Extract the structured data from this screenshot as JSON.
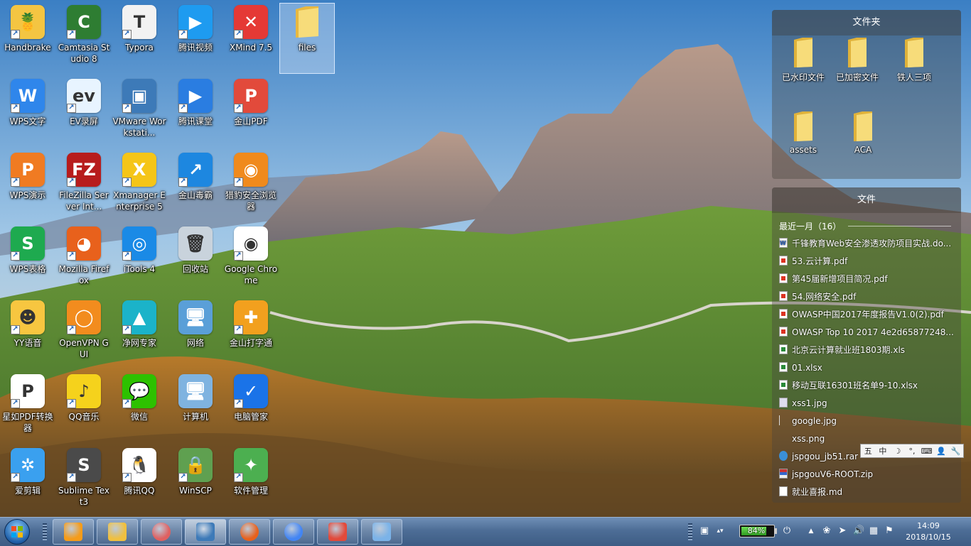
{
  "desktop": {
    "icons": [
      {
        "label": "Handbrake",
        "icon": "pineapple-icon",
        "bg": "#f4c542",
        "glyph": "🍍"
      },
      {
        "label": "Camtasia Studio 8",
        "icon": "camtasia-icon",
        "bg": "#2e7d32",
        "glyph": "C"
      },
      {
        "label": "Typora",
        "icon": "typora-icon",
        "bg": "#f2f2f2",
        "glyph": "T"
      },
      {
        "label": "腾讯视频",
        "icon": "tencent-video-icon",
        "bg": "#1e9bf0",
        "glyph": "▶"
      },
      {
        "label": "XMind 7.5",
        "icon": "xmind-icon",
        "bg": "#e53935",
        "glyph": "✕"
      },
      {
        "label": "files",
        "icon": "folder-icon",
        "bg": "#f3d36b",
        "glyph": ""
      },
      {
        "label": "WPS文字",
        "icon": "wps-writer-icon",
        "bg": "#2f86eb",
        "glyph": "W"
      },
      {
        "label": "EV录屏",
        "icon": "ev-recorder-icon",
        "bg": "#e8f4ff",
        "glyph": "ev"
      },
      {
        "label": "VMware Workstati...",
        "icon": "vmware-icon",
        "bg": "#3d7ab8",
        "glyph": "▣"
      },
      {
        "label": "腾讯课堂",
        "icon": "tencent-class-icon",
        "bg": "#2a7de1",
        "glyph": "▶"
      },
      {
        "label": "金山PDF",
        "icon": "kingsoft-pdf-icon",
        "bg": "#e24a3b",
        "glyph": "P"
      },
      {
        "label": "WPS演示",
        "icon": "wps-presentation-icon",
        "bg": "#f07b22",
        "glyph": "P"
      },
      {
        "label": "FileZilla Server Int...",
        "icon": "filezilla-icon",
        "bg": "#b71c1c",
        "glyph": "FZ"
      },
      {
        "label": "Xmanager Enterprise 5",
        "icon": "xmanager-icon",
        "bg": "#f5c518",
        "glyph": "X"
      },
      {
        "label": "金山毒霸",
        "icon": "kingsoft-antivirus-icon",
        "bg": "#1d87e0",
        "glyph": "↗"
      },
      {
        "label": "猎豹安全浏览器",
        "icon": "liebao-browser-icon",
        "bg": "#f08a1c",
        "glyph": "◉"
      },
      {
        "label": "WPS表格",
        "icon": "wps-spreadsheet-icon",
        "bg": "#1eaa4f",
        "glyph": "S"
      },
      {
        "label": "Mozilla Firefox",
        "icon": "firefox-icon",
        "bg": "#e8611c",
        "glyph": "◕"
      },
      {
        "label": "iTools 4",
        "icon": "itools-icon",
        "bg": "#1a8ae6",
        "glyph": "◎"
      },
      {
        "label": "回收站",
        "icon": "recycle-bin-icon",
        "bg": "#c9d3dc",
        "glyph": "🗑"
      },
      {
        "label": "Google Chrome",
        "icon": "chrome-icon",
        "bg": "#ffffff",
        "glyph": "◉"
      },
      {
        "label": "YY语音",
        "icon": "yy-voice-icon",
        "bg": "#f7c640",
        "glyph": "☻"
      },
      {
        "label": "OpenVPN GUI",
        "icon": "openvpn-icon",
        "bg": "#f28c1e",
        "glyph": "◯"
      },
      {
        "label": "净网专家",
        "icon": "jingwang-icon",
        "bg": "#1bb3c9",
        "glyph": "▲"
      },
      {
        "label": "网络",
        "icon": "network-icon",
        "bg": "#5a9fd8",
        "glyph": "🖥"
      },
      {
        "label": "金山打字通",
        "icon": "kingsoft-typing-icon",
        "bg": "#f2a01e",
        "glyph": "✚"
      },
      {
        "label": "星如PDF转换器",
        "icon": "pdf-converter-icon",
        "bg": "#ffffff",
        "glyph": "P"
      },
      {
        "label": "QQ音乐",
        "icon": "qq-music-icon",
        "bg": "#f5d21c",
        "glyph": "♪"
      },
      {
        "label": "微信",
        "icon": "wechat-icon",
        "bg": "#2dc100",
        "glyph": "💬"
      },
      {
        "label": "计算机",
        "icon": "computer-icon",
        "bg": "#7fb3e0",
        "glyph": "🖥"
      },
      {
        "label": "电脑管家",
        "icon": "pc-manager-icon",
        "bg": "#1a73e8",
        "glyph": "✓"
      },
      {
        "label": "爱剪辑",
        "icon": "aijianji-icon",
        "bg": "#3aa0ef",
        "glyph": "✲"
      },
      {
        "label": "Sublime Text3",
        "icon": "sublime-icon",
        "bg": "#4a4a4a",
        "glyph": "S"
      },
      {
        "label": "腾讯QQ",
        "icon": "qq-icon",
        "bg": "#ffffff",
        "glyph": "🐧"
      },
      {
        "label": "WinSCP",
        "icon": "winscp-icon",
        "bg": "#5fa050",
        "glyph": "🔒"
      },
      {
        "label": "软件管理",
        "icon": "software-manager-icon",
        "bg": "#4caf50",
        "glyph": "✦"
      }
    ]
  },
  "folders_panel": {
    "title": "文件夹",
    "items": [
      "已水印文件",
      "已加密文件",
      "铁人三项",
      "assets",
      "ACA"
    ]
  },
  "files_panel": {
    "title": "文件",
    "recent_label": "最近一月（16）",
    "files": [
      {
        "name": "千锋教育Web安全渗透攻防项目实战.do...",
        "type": "word"
      },
      {
        "name": "53.云计算.pdf",
        "type": "pdf"
      },
      {
        "name": "第45届新增项目简况.pdf",
        "type": "pdf"
      },
      {
        "name": "54.网络安全.pdf",
        "type": "pdf"
      },
      {
        "name": "OWASP中国2017年度报告V1.0(2).pdf",
        "type": "pdf"
      },
      {
        "name": "OWASP Top 10 2017 4e2d65877248...",
        "type": "pdf"
      },
      {
        "name": "北京云计算就业班1803期.xls",
        "type": "xls"
      },
      {
        "name": "01.xlsx",
        "type": "xls"
      },
      {
        "name": "移动互联16301班名单9-10.xlsx",
        "type": "xls"
      },
      {
        "name": "xss1.jpg",
        "type": "img"
      },
      {
        "name": "google.jpg",
        "type": "blank"
      },
      {
        "name": "xss.png",
        "type": "none"
      },
      {
        "name": "jspgou_jb51.rar",
        "type": "rar"
      },
      {
        "name": "jspgouV6-ROOT.zip",
        "type": "zip"
      },
      {
        "name": "就业喜报.md",
        "type": "md"
      }
    ]
  },
  "ime_bar": {
    "items": [
      "五",
      "中",
      "☽",
      "°,",
      "⌨",
      "👤",
      "🔧"
    ]
  },
  "taskbar": {
    "pinned": [
      {
        "name": "media-player",
        "icon": "media-player-icon",
        "color": "#f59c1a"
      },
      {
        "name": "file-explorer",
        "icon": "file-explorer-icon",
        "color": "#f0c040"
      },
      {
        "name": "snail-app",
        "icon": "snail-icon",
        "color": "#e06060"
      },
      {
        "name": "vmware",
        "icon": "vmware-icon",
        "color": "#3d7ab8"
      },
      {
        "name": "firefox",
        "icon": "firefox-icon",
        "color": "#e8611c"
      },
      {
        "name": "chrome",
        "icon": "chrome-icon",
        "color": "#4285f4"
      },
      {
        "name": "kingsoft-pdf",
        "icon": "kingsoft-pdf-icon",
        "color": "#e24a3b"
      },
      {
        "name": "paint",
        "icon": "paint-icon",
        "color": "#7bb3e8"
      }
    ],
    "battery_percent": "84%",
    "battery_level": 0.84,
    "clock_time": "14:09",
    "clock_date": "2018/10/15"
  }
}
